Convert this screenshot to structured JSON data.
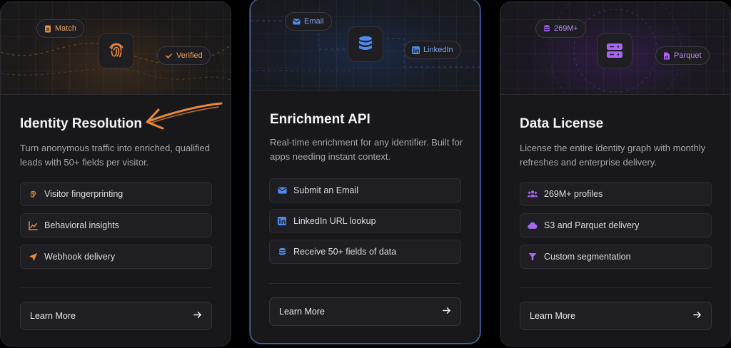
{
  "cards": [
    {
      "title": "Identity Resolution",
      "description": "Turn anonymous traffic into enriched, qualified leads with 50+ fields per visitor.",
      "pills": [
        {
          "label": "Match",
          "icon": "badge-icon"
        },
        {
          "label": "Verified",
          "icon": "check-icon"
        }
      ],
      "center_icon": "fingerprint-icon",
      "features": [
        {
          "label": "Visitor fingerprinting",
          "icon": "fingerprint-icon"
        },
        {
          "label": "Behavioral insights",
          "icon": "line-chart-icon"
        },
        {
          "label": "Webhook delivery",
          "icon": "paper-plane-icon"
        }
      ],
      "cta": "Learn More",
      "accent": "#e8893a"
    },
    {
      "title": "Enrichment API",
      "description": "Real-time enrichment for any identifier. Built for apps needing instant context.",
      "pills": [
        {
          "label": "Email",
          "icon": "envelope-icon"
        },
        {
          "label": "LinkedIn",
          "icon": "linkedin-icon"
        }
      ],
      "center_icon": "database-icon",
      "features": [
        {
          "label": "Submit an Email",
          "icon": "envelope-icon"
        },
        {
          "label": "LinkedIn URL lookup",
          "icon": "linkedin-icon"
        },
        {
          "label": "Receive 50+ fields of data",
          "icon": "database-icon"
        }
      ],
      "cta": "Learn More",
      "accent": "#4f8bef"
    },
    {
      "title": "Data License",
      "description": "License the entire identity graph with monthly refreshes and enterprise delivery.",
      "pills": [
        {
          "label": "269M+",
          "icon": "database-icon"
        },
        {
          "label": "Parquet",
          "icon": "file-icon"
        }
      ],
      "center_icon": "server-icon",
      "features": [
        {
          "label": "269M+ profiles",
          "icon": "users-icon"
        },
        {
          "label": "S3 and Parquet delivery",
          "icon": "cloud-icon"
        },
        {
          "label": "Custom segmentation",
          "icon": "filter-icon"
        }
      ],
      "cta": "Learn More",
      "accent": "#a665f2"
    }
  ]
}
